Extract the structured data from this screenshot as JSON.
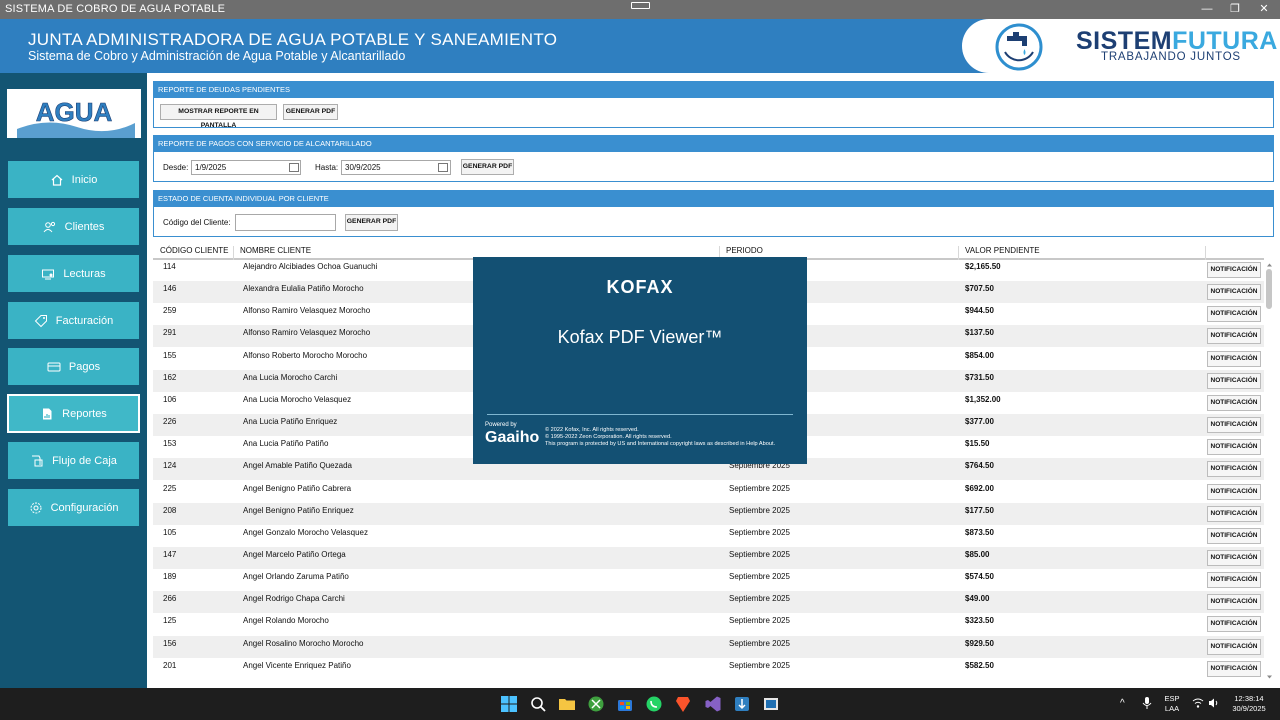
{
  "window": {
    "title": "SISTEMA DE COBRO DE AGUA POTABLE",
    "controls": [
      "—",
      "❐",
      "✕"
    ]
  },
  "header": {
    "title": "JUNTA ADMINISTRADORA DE AGUA POTABLE Y SANEAMIENTO",
    "subtitle": "Sistema de Cobro y Administración de Agua Potable y Alcantarillado",
    "brand_part1": "SISTEM",
    "brand_part2": "FUTURA",
    "brand_tagline": "TRABAJANDO JUNTOS"
  },
  "sidebar": {
    "logo_text": "AGUA",
    "items": [
      {
        "label": "Inicio",
        "icon": "home-icon"
      },
      {
        "label": "Clientes",
        "icon": "users-icon"
      },
      {
        "label": "Lecturas",
        "icon": "meter-icon"
      },
      {
        "label": "Facturación",
        "icon": "tag-icon"
      },
      {
        "label": "Pagos",
        "icon": "card-icon"
      },
      {
        "label": "Reportes",
        "icon": "report-icon"
      },
      {
        "label": "Flujo de Caja",
        "icon": "cashflow-icon"
      },
      {
        "label": "Configuración",
        "icon": "gear-icon"
      }
    ],
    "active": "Reportes"
  },
  "sections": {
    "deudas": {
      "title": "REPORTE DE DEUDAS PENDIENTES",
      "show_label": "MOSTRAR REPORTE EN PANTALLA",
      "pdf_label": "GENERAR PDF"
    },
    "pagos": {
      "title": "REPORTE DE PAGOS CON SERVICIO DE ALCANTARILLADO",
      "desde_label": "Desde:",
      "desde_value": "1/9/2025",
      "hasta_label": "Hasta:",
      "hasta_value": "30/9/2025",
      "pdf_label": "GENERAR PDF"
    },
    "estado": {
      "title": "ESTADO DE CUENTA INDIVIDUAL POR CLIENTE",
      "codigo_label": "Código del Cliente:",
      "codigo_value": "",
      "pdf_label": "GENERAR PDF"
    }
  },
  "table": {
    "columns": [
      "CÓDIGO CLIENTE",
      "NOMBRE CLIENTE",
      "PERIODO",
      "VALOR PENDIENTE"
    ],
    "action_label": "NOTIFICACIÓN",
    "rows": [
      {
        "code": "114",
        "name": "Alejandro Alcibiades Ochoa Guanuchi",
        "period": "",
        "value": "$2,165.50"
      },
      {
        "code": "146",
        "name": "Alexandra Eulalia Patiño Morocho",
        "period": "",
        "value": "$707.50"
      },
      {
        "code": "259",
        "name": "Alfonso Ramiro Velasquez Morocho",
        "period": "",
        "value": "$944.50"
      },
      {
        "code": "291",
        "name": "Alfonso Ramiro Velasquez Morocho",
        "period": "",
        "value": "$137.50"
      },
      {
        "code": "155",
        "name": "Alfonso Roberto Morocho Morocho",
        "period": "",
        "value": "$854.00"
      },
      {
        "code": "162",
        "name": "Ana Lucia Morocho Carchi",
        "period": "",
        "value": "$731.50"
      },
      {
        "code": "106",
        "name": "Ana Lucia Morocho Velasquez",
        "period": "",
        "value": "$1,352.00"
      },
      {
        "code": "226",
        "name": "Ana Lucia Patiño Enriquez",
        "period": "",
        "value": "$377.00"
      },
      {
        "code": "153",
        "name": "Ana Lucia Patiño Patiño",
        "period": "",
        "value": "$15.50"
      },
      {
        "code": "124",
        "name": "Angel Amable Patiño Quezada",
        "period": "Septiembre 2025",
        "value": "$764.50"
      },
      {
        "code": "225",
        "name": "Angel Benigno Patiño Cabrera",
        "period": "Septiembre 2025",
        "value": "$692.00"
      },
      {
        "code": "208",
        "name": "Angel Benigno Patiño Enriquez",
        "period": "Septiembre 2025",
        "value": "$177.50"
      },
      {
        "code": "105",
        "name": "Angel Gonzalo Morocho Velasquez",
        "period": "Septiembre 2025",
        "value": "$873.50"
      },
      {
        "code": "147",
        "name": "Angel Marcelo Patiño Ortega",
        "period": "Septiembre 2025",
        "value": "$85.00"
      },
      {
        "code": "189",
        "name": "Angel Orlando Zaruma Patiño",
        "period": "Septiembre 2025",
        "value": "$574.50"
      },
      {
        "code": "266",
        "name": "Angel Rodrigo Chapa Carchi",
        "period": "Septiembre 2025",
        "value": "$49.00"
      },
      {
        "code": "125",
        "name": "Angel Rolando Morocho",
        "period": "Septiembre 2025",
        "value": "$323.50"
      },
      {
        "code": "156",
        "name": "Angel Rosalino Morocho Morocho",
        "period": "Septiembre 2025",
        "value": "$929.50"
      },
      {
        "code": "201",
        "name": "Angel Vicente Enriquez Patiño",
        "period": "Septiembre 2025",
        "value": "$582.50"
      }
    ]
  },
  "splash": {
    "brand": "KOFAX",
    "product": "Kofax PDF Viewer™",
    "powered": "Powered by",
    "gaaiho": "Gaaiho",
    "copyright1": "© 2022 Kofax, Inc. All rights reserved.",
    "copyright2": "© 1995-2022 Zeon Corporation. All rights reserved.",
    "copyright3": "This program is protected by US and International copyright laws as described in Help About."
  },
  "taskbar": {
    "lang1": "ESP",
    "lang2": "LAA",
    "time": "12:38:14",
    "date": "30/9/2025"
  },
  "colors": {
    "header": "#2f7fc0",
    "sidebar": "#135573",
    "nav": "#3ab3c5",
    "section": "#3a8fd0",
    "splash": "#135073"
  }
}
